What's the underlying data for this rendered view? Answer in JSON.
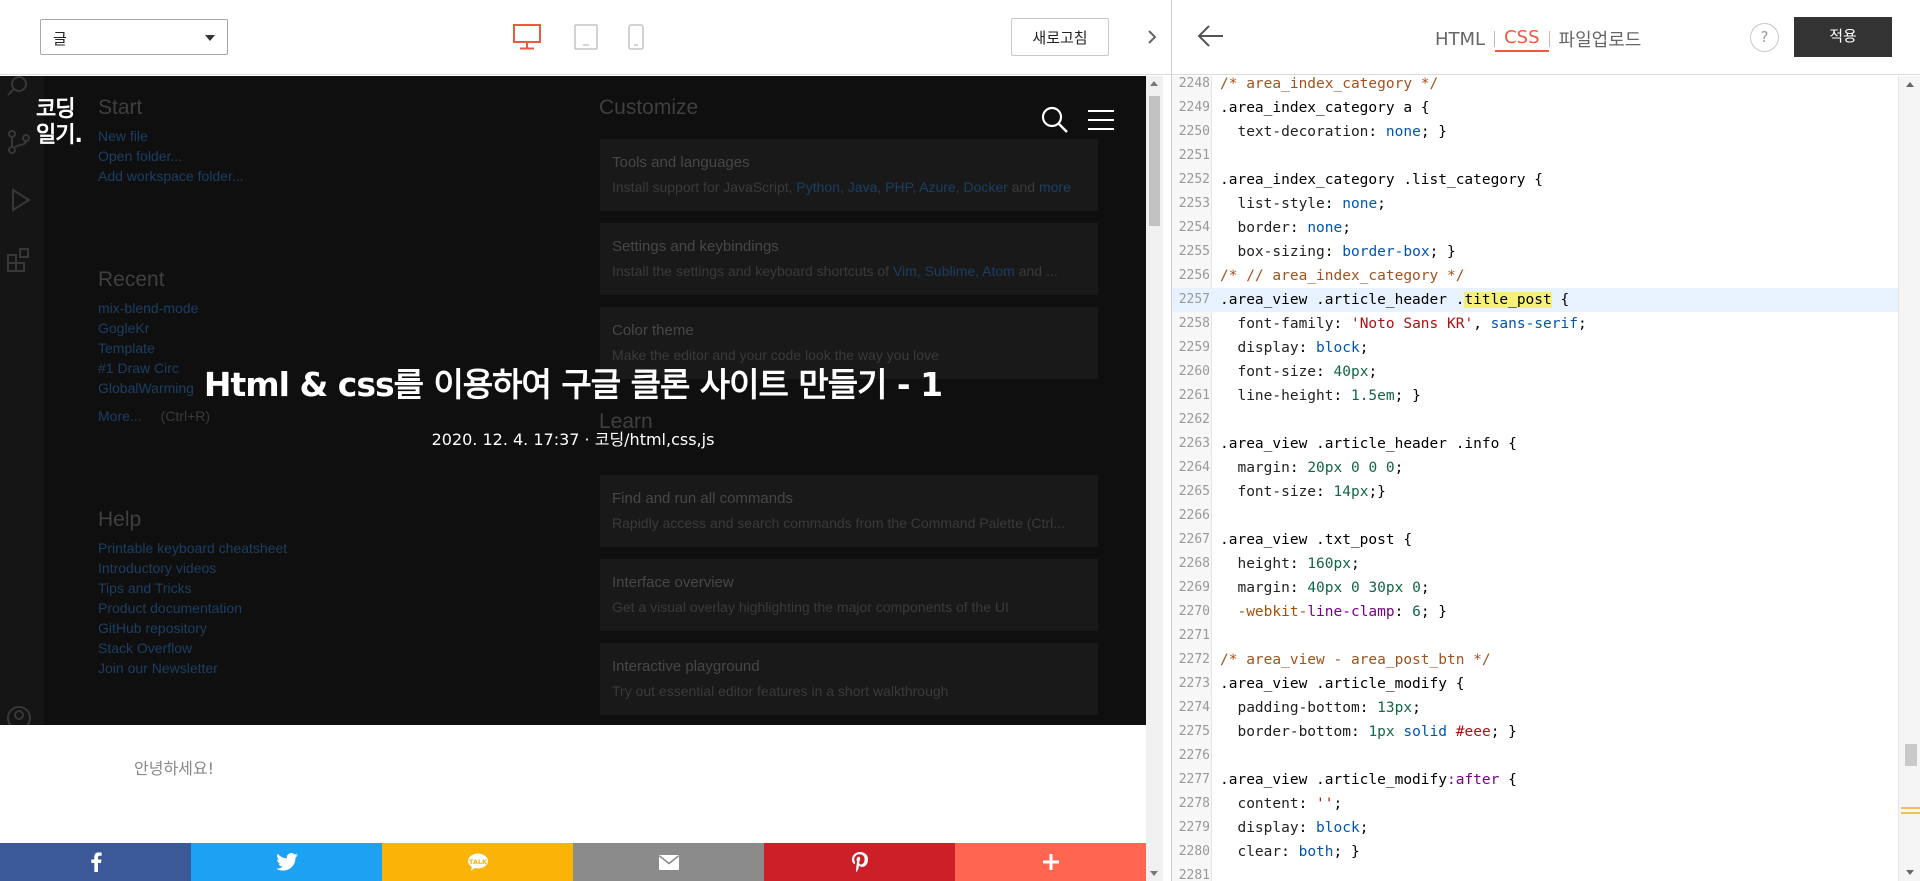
{
  "left_toolbar": {
    "page_select_value": "글",
    "refresh_label": "새로고침"
  },
  "hero": {
    "blog_logo_line1": "코딩",
    "blog_logo_line2": "일기.",
    "post_title": "Html & css를 이용하여 구글 클론 사이트 만들기 - 1",
    "post_info": "2020. 12. 4. 17:37 · 코딩/html,css,js",
    "vscode_welcome": {
      "start_heading": "Start",
      "start_links": [
        "New file",
        "Open folder...",
        "Add workspace folder..."
      ],
      "recent_heading": "Recent",
      "recent_items": [
        "mix-blend-mode",
        "GogleKr",
        "Template",
        "#1 Draw Circ",
        "GlobalWarming"
      ],
      "more_label": "More...",
      "more_shortcut": "(Ctrl+R)",
      "help_heading": "Help",
      "help_links": [
        "Printable keyboard cheatsheet",
        "Introductory videos",
        "Tips and Tricks",
        "Product documentation",
        "GitHub repository",
        "Stack Overflow",
        "Join our Newsletter"
      ],
      "customize_heading": "Customize",
      "learn_heading": "Learn",
      "cards": [
        {
          "title": "Tools and languages",
          "desc_prefix": "Install support for JavaScript, ",
          "desc_links": "Python, Java, PHP, Azure, Docker",
          "desc_mid": " and ",
          "desc_suffix": "more"
        },
        {
          "title": "Settings and keybindings",
          "desc_prefix": "Install the settings and keyboard shortcuts of ",
          "desc_links": "Vim, Sublime, Atom",
          "desc_mid": " and ...",
          "desc_suffix": ""
        },
        {
          "title": "Color theme",
          "desc_prefix": "Make the editor and your code look the way you love",
          "desc_links": "",
          "desc_mid": "",
          "desc_suffix": ""
        },
        {
          "title": "Find and run all commands",
          "desc_prefix": "Rapidly access and search commands from the Command Palette (Ctrl...",
          "desc_links": "",
          "desc_mid": "",
          "desc_suffix": ""
        },
        {
          "title": "Interface overview",
          "desc_prefix": "Get a visual overlay highlighting the major components of the UI",
          "desc_links": "",
          "desc_mid": "",
          "desc_suffix": ""
        },
        {
          "title": "Interactive playground",
          "desc_prefix": "Try out essential editor features in a short walkthrough",
          "desc_links": "",
          "desc_mid": "",
          "desc_suffix": ""
        }
      ]
    }
  },
  "greeting": "안녕하세요!",
  "share_bar": [
    {
      "name": "facebook",
      "color": "#3b5998"
    },
    {
      "name": "twitter",
      "color": "#1da1f2"
    },
    {
      "name": "kakaostory",
      "color": "#fbb307"
    },
    {
      "name": "email",
      "color": "#8b8b8b"
    },
    {
      "name": "pinterest",
      "color": "#cb2027"
    },
    {
      "name": "more",
      "color": "#ff6550"
    }
  ],
  "right_toolbar": {
    "tabs": [
      "HTML",
      "CSS",
      "파일업로드"
    ],
    "active_tab": "CSS",
    "help_label": "?",
    "apply_label": "적용"
  },
  "code_lines": [
    {
      "n": "2248",
      "t": "/* area_index_category */"
    },
    {
      "n": "2249",
      "t": ".area_index_category a {"
    },
    {
      "n": "2250",
      "t": "  text-decoration: none; }"
    },
    {
      "n": "2251",
      "t": ""
    },
    {
      "n": "2252",
      "t": ".area_index_category .list_category {"
    },
    {
      "n": "2253",
      "t": "  list-style: none;"
    },
    {
      "n": "2254",
      "t": "  border: none;"
    },
    {
      "n": "2255",
      "t": "  box-sizing: border-box; }"
    },
    {
      "n": "2256",
      "t": "/* // area_index_category */"
    },
    {
      "n": "2257",
      "t": ".area_view .article_header .title_post {"
    },
    {
      "n": "2258",
      "t": "  font-family: 'Noto Sans KR', sans-serif;"
    },
    {
      "n": "2259",
      "t": "  display: block;"
    },
    {
      "n": "2260",
      "t": "  font-size: 40px;"
    },
    {
      "n": "2261",
      "t": "  line-height: 1.5em; }"
    },
    {
      "n": "2262",
      "t": ""
    },
    {
      "n": "2263",
      "t": ".area_view .article_header .info {"
    },
    {
      "n": "2264",
      "t": "  margin: 20px 0 0 0;"
    },
    {
      "n": "2265",
      "t": "  font-size: 14px;}"
    },
    {
      "n": "2266",
      "t": ""
    },
    {
      "n": "2267",
      "t": ".area_view .txt_post {"
    },
    {
      "n": "2268",
      "t": "  height: 160px;"
    },
    {
      "n": "2269",
      "t": "  margin: 40px 0 30px 0;"
    },
    {
      "n": "2270",
      "t": "  -webkit-line-clamp: 6; }"
    },
    {
      "n": "2271",
      "t": ""
    },
    {
      "n": "2272",
      "t": "/* area_view - area_post_btn */"
    },
    {
      "n": "2273",
      "t": ".area_view .article_modify {"
    },
    {
      "n": "2274",
      "t": "  padding-bottom: 13px;"
    },
    {
      "n": "2275",
      "t": "  border-bottom: 1px solid #eee; }"
    },
    {
      "n": "2276",
      "t": ""
    },
    {
      "n": "2277",
      "t": ".area_view .article_modify:after {"
    },
    {
      "n": "2278",
      "t": "  content: '';"
    },
    {
      "n": "2279",
      "t": "  display: block;"
    },
    {
      "n": "2280",
      "t": "  clear: both; }"
    },
    {
      "n": "2281",
      "t": ""
    }
  ],
  "highlighted_line": "2257",
  "colors": {
    "accent": "#ef5a3c",
    "apply_bg": "#333333",
    "hero_bg": "#0f0f0f"
  }
}
